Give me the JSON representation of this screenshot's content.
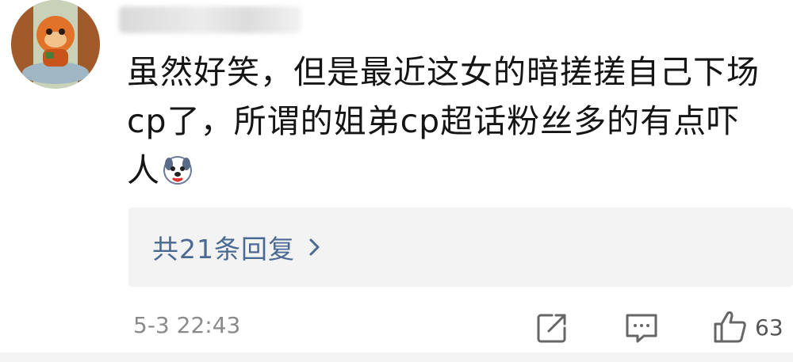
{
  "comment": {
    "avatar_icon": "cartoon-avatar-icon",
    "text_lines": [
      "虽然好笑，但是最近这女的暗搓搓自己下场",
      "cp了，所谓的姐弟cp超话粉丝多的有点吓",
      "人"
    ],
    "emoji_icon": "dog-face-emoji-icon",
    "replies_label": "共21条回复",
    "timestamp": "5-3 22:43",
    "like_count": "63"
  },
  "colors": {
    "link": "#4a6a93",
    "reply_box_bg": "#f3f3f3",
    "meta_text": "#8a8a8a"
  }
}
